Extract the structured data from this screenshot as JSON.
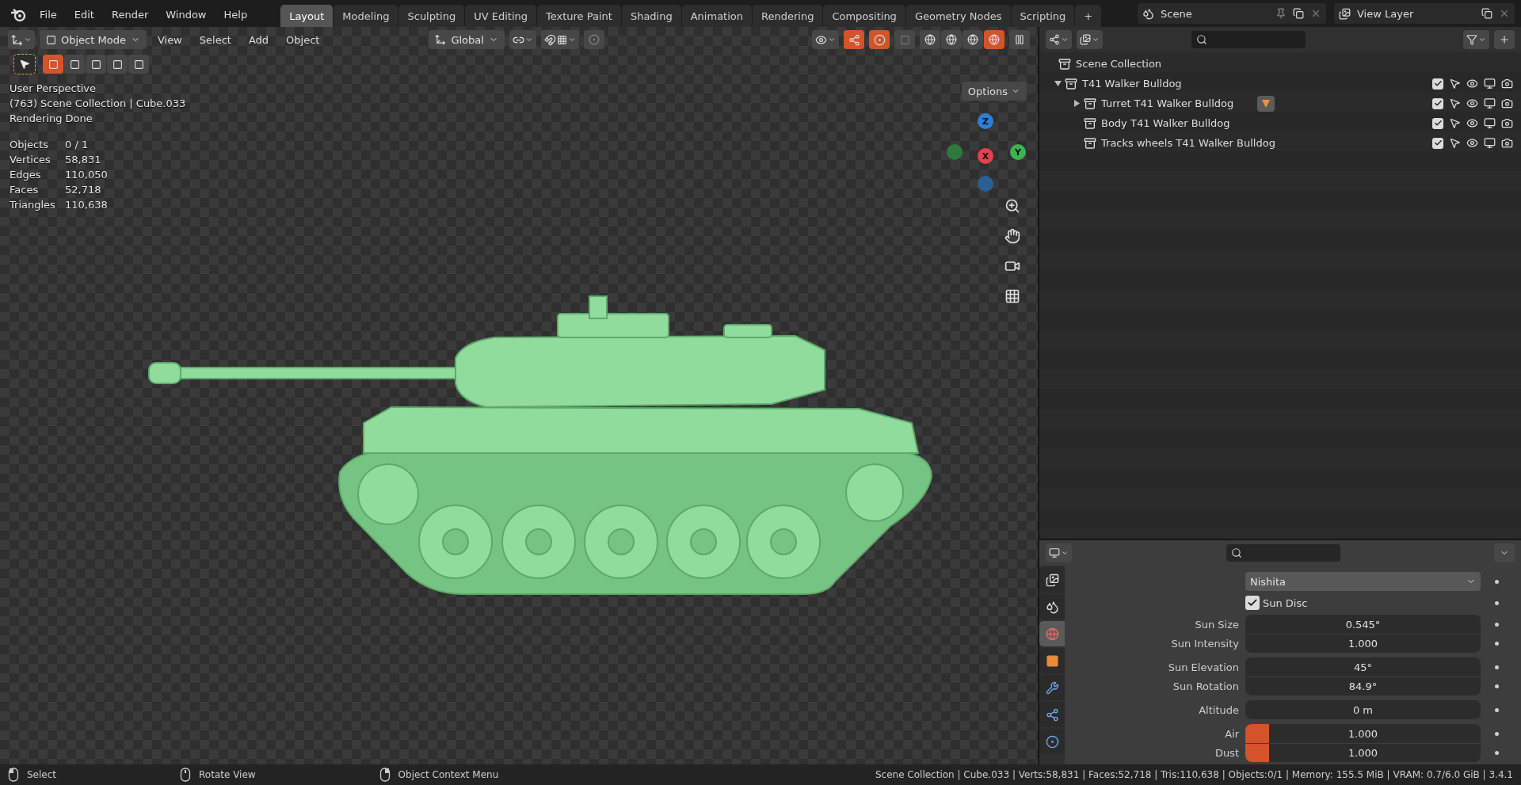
{
  "menu": [
    "File",
    "Edit",
    "Render",
    "Window",
    "Help"
  ],
  "workspaces": [
    {
      "label": "Layout",
      "selected": true
    },
    {
      "label": "Modeling",
      "selected": false
    },
    {
      "label": "Sculpting",
      "selected": false
    },
    {
      "label": "UV Editing",
      "selected": false
    },
    {
      "label": "Texture Paint",
      "selected": false
    },
    {
      "label": "Shading",
      "selected": false
    },
    {
      "label": "Animation",
      "selected": false
    },
    {
      "label": "Rendering",
      "selected": false
    },
    {
      "label": "Compositing",
      "selected": false
    },
    {
      "label": "Geometry Nodes",
      "selected": false
    },
    {
      "label": "Scripting",
      "selected": false
    }
  ],
  "add_workspace": "+",
  "scene": "Scene",
  "view_layer": "View Layer",
  "viewport": {
    "mode": "Object Mode",
    "menus": [
      "View",
      "Select",
      "Add",
      "Object"
    ],
    "orientation": "Global",
    "select_modes": [
      {
        "selected": true
      },
      {
        "selected": false
      },
      {
        "selected": false
      },
      {
        "selected": false
      },
      {
        "selected": false
      }
    ],
    "shading": [
      {
        "selected": false
      },
      {
        "selected": false
      },
      {
        "selected": false
      },
      {
        "selected": true
      }
    ],
    "options": "Options",
    "info": [
      "User Perspective",
      "(763) Scene Collection | Cube.033",
      "Rendering Done"
    ],
    "stats": [
      {
        "label": "Objects",
        "value": "0 / 1"
      },
      {
        "label": "Vertices",
        "value": "58,831"
      },
      {
        "label": "Edges",
        "value": "110,050"
      },
      {
        "label": "Faces",
        "value": "52,718"
      },
      {
        "label": "Triangles",
        "value": "110,638"
      }
    ],
    "axes": [
      {
        "label": "Z",
        "color": "#2e7fd8"
      },
      {
        "label": "X",
        "color": "#e2424d"
      },
      {
        "label": "Y",
        "color": "#3fb152"
      }
    ]
  },
  "outliner": {
    "root": "Scene Collection",
    "items": [
      {
        "label": "T41 Walker Bulldog",
        "expandable": true,
        "expanded": true,
        "modifier": false,
        "checked": true,
        "children": [
          {
            "label": "Turret T41 Walker Bulldog",
            "expandable": true,
            "expanded": false,
            "modifier": true,
            "checked": true
          },
          {
            "label": "Body T41 Walker Bulldog",
            "expandable": false,
            "modifier": false,
            "checked": true
          },
          {
            "label": "Tracks wheels T41 Walker Bulldog",
            "expandable": false,
            "modifier": false,
            "checked": true
          }
        ]
      }
    ]
  },
  "properties": {
    "tabs": [
      {
        "kind": "output",
        "selected": false
      },
      {
        "kind": "scene",
        "selected": false
      },
      {
        "kind": "world",
        "selected": true
      },
      {
        "kind": "object",
        "selected": false
      },
      {
        "kind": "modifiers",
        "selected": false
      },
      {
        "kind": "particles",
        "selected": false
      },
      {
        "kind": "physics",
        "selected": false
      }
    ],
    "sky_type": "Nishita",
    "sun_disc": {
      "label": "Sun Disc",
      "checked": true
    },
    "groups": [
      {
        "fields": [
          {
            "label": "Sun Size",
            "value": "0.545°"
          },
          {
            "label": "Sun Intensity",
            "value": "1.000"
          }
        ]
      },
      {
        "fields": [
          {
            "label": "Sun Elevation",
            "value": "45°"
          },
          {
            "label": "Sun Rotation",
            "value": "84.9°"
          }
        ]
      },
      {
        "fields": [
          {
            "label": "Altitude",
            "value": "0 m"
          }
        ]
      },
      {
        "fields": [
          {
            "label": "Air",
            "value": "1.000",
            "level": 0.1
          },
          {
            "label": "Dust",
            "value": "1.000",
            "level": 0.1
          }
        ]
      }
    ]
  },
  "status_bar": {
    "hints": [
      {
        "kind": "left",
        "label": "Select"
      },
      {
        "kind": "middle",
        "label": "Rotate View"
      },
      {
        "kind": "right",
        "label": "Object Context Menu"
      }
    ],
    "info": "Scene Collection | Cube.033 | Verts:58,831 | Faces:52,718 | Tris:110,638 | Objects:0/1 | Memory: 155.5 MiB | VRAM: 0.7/6.0 GiB | 3.4.1"
  }
}
